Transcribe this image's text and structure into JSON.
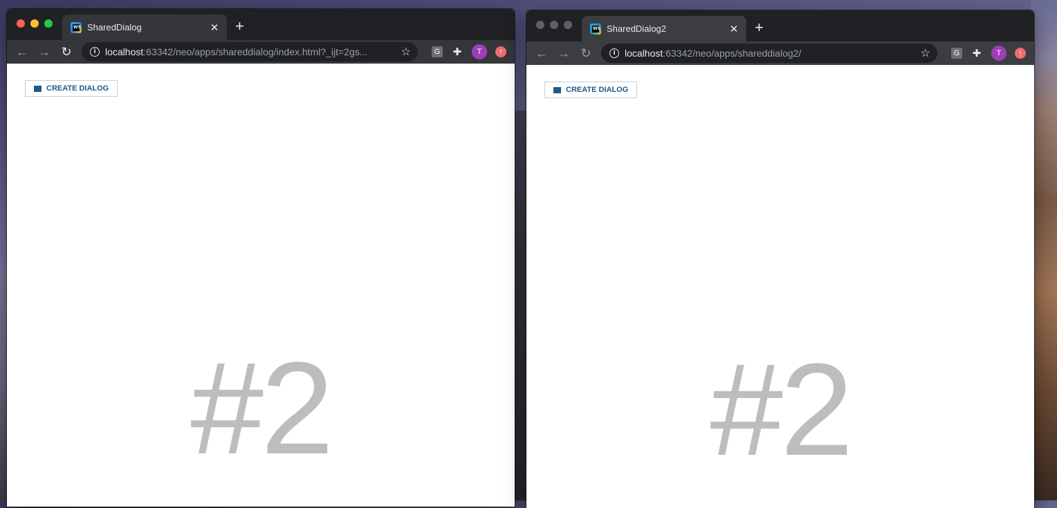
{
  "windows": [
    {
      "tab": {
        "title": "SharedDialog",
        "favicon": "webstorm-icon"
      },
      "toolbar": {
        "url_host": "localhost",
        "url_rest": ":63342/neo/apps/shareddialog/index.html?_ijt=2gs...",
        "extension_letter": "G",
        "avatar_initial": "T"
      },
      "content": {
        "create_button_label": "CREATE DIALOG",
        "big_text": "#2"
      }
    },
    {
      "tab": {
        "title": "SharedDialog2",
        "favicon": "webstorm-icon"
      },
      "toolbar": {
        "url_host": "localhost",
        "url_rest": ":63342/neo/apps/shareddialog2/",
        "extension_letter": "G",
        "avatar_initial": "T"
      },
      "content": {
        "create_button_label": "CREATE DIALOG",
        "big_text": "#2"
      }
    }
  ],
  "colors": {
    "tab_strip": "#202124",
    "toolbar": "#35363a",
    "button_text": "#1d5a8c",
    "big_text": "#bdbdbd",
    "avatar": "#9c3fb9"
  }
}
